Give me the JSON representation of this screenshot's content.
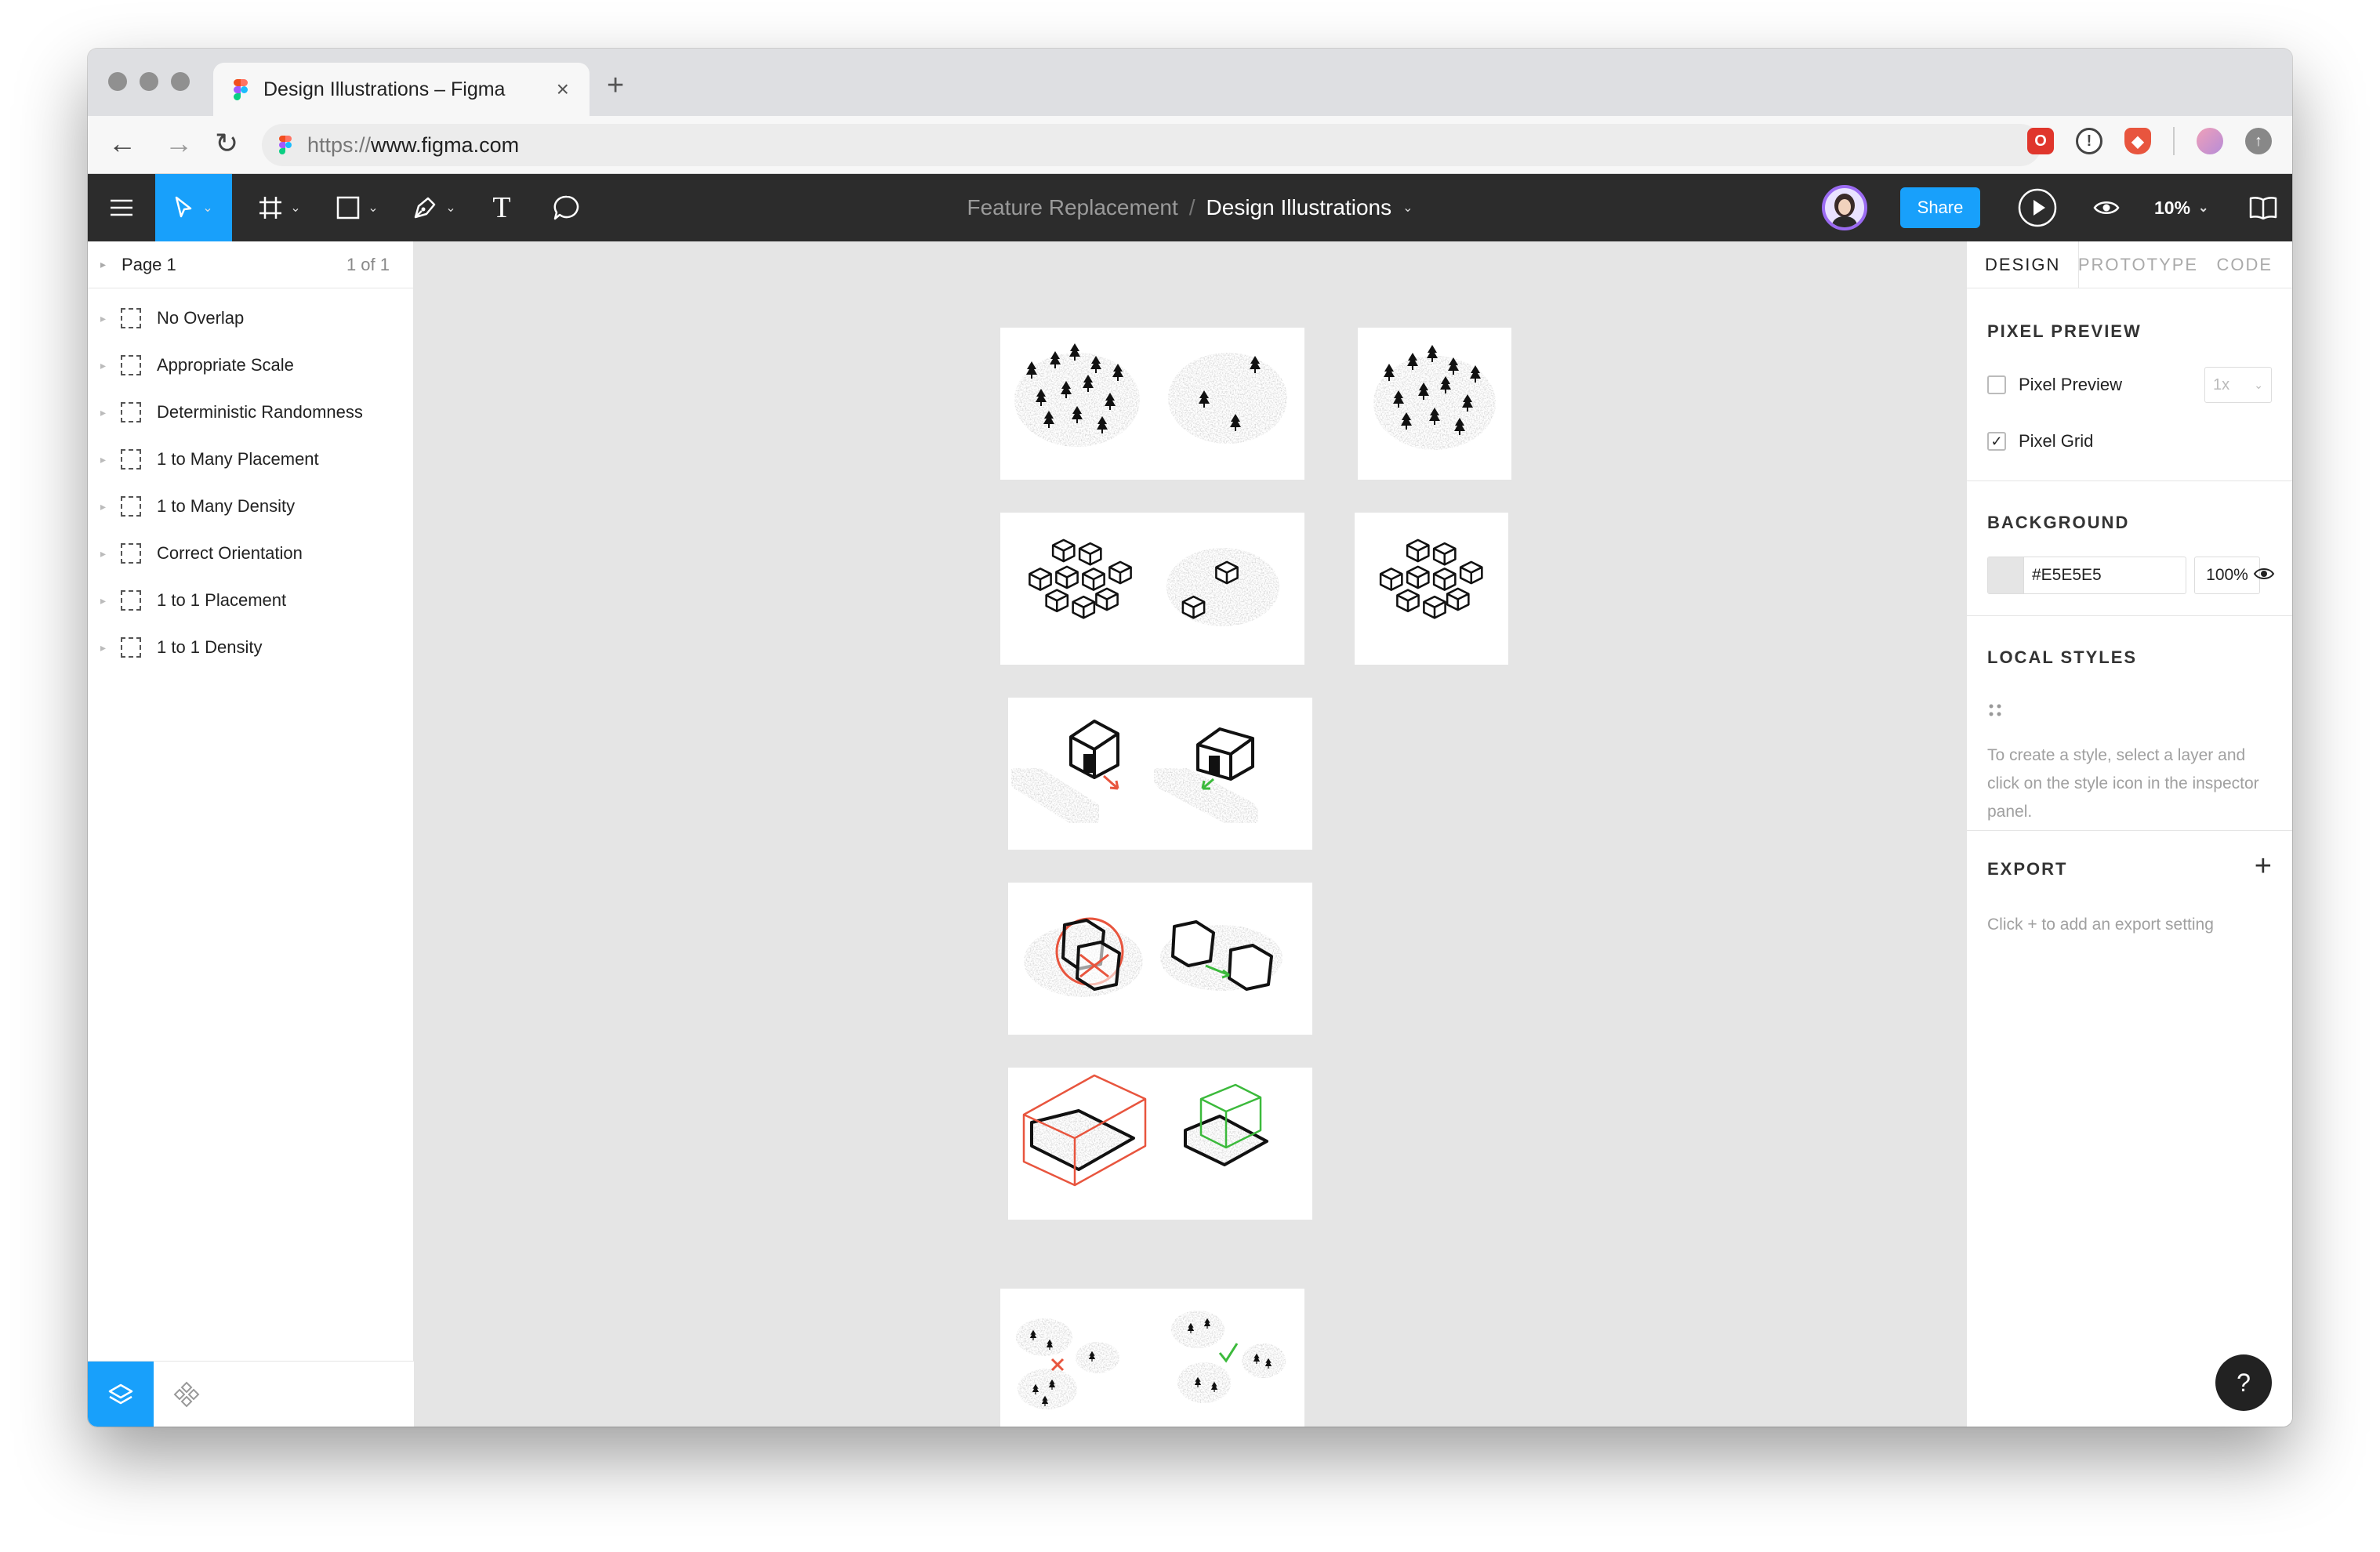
{
  "browser": {
    "tab_title": "Design Illustrations – Figma",
    "tab_close": "×",
    "new_tab": "+",
    "url_scheme": "https://",
    "url_host": "www.figma.com",
    "back": "←",
    "forward": "→",
    "reload": "↻"
  },
  "toolbar": {
    "project": "Feature Replacement",
    "separator": "/",
    "file": "Design Illustrations",
    "share_label": "Share",
    "zoom": "10%",
    "text_tool": "T"
  },
  "layers_panel": {
    "page_name": "Page 1",
    "page_count": "1 of 1",
    "frames": [
      "No Overlap",
      "Appropriate Scale",
      "Deterministic Randomness",
      "1 to Many Placement",
      "1 to Many Density",
      "Correct Orientation",
      "1 to 1 Placement",
      "1 to 1 Density"
    ]
  },
  "inspector": {
    "tabs": [
      "DESIGN",
      "PROTOTYPE",
      "CODE"
    ],
    "pixel_preview": {
      "heading": "PIXEL PREVIEW",
      "preview_label": "Pixel Preview",
      "preview_checked": false,
      "preview_scale": "1x",
      "grid_label": "Pixel Grid",
      "grid_checked": true
    },
    "background": {
      "heading": "BACKGROUND",
      "color": "#E5E5E5",
      "opacity": "100%"
    },
    "local_styles": {
      "heading": "LOCAL STYLES",
      "hint": "To create a style, select a layer and click on the style icon in the inspector panel."
    },
    "export": {
      "heading": "EXPORT",
      "add": "+",
      "hint": "Click + to add an export setting"
    },
    "help": "?"
  },
  "colors": {
    "figma_blue": "#18a0fb",
    "toolbar_dark": "#2c2c2c",
    "canvas_bg": "#e5e5e5",
    "error_red": "#e8553e",
    "success_green": "#3cba3c",
    "avatar_ring": "#9b6bf2"
  }
}
